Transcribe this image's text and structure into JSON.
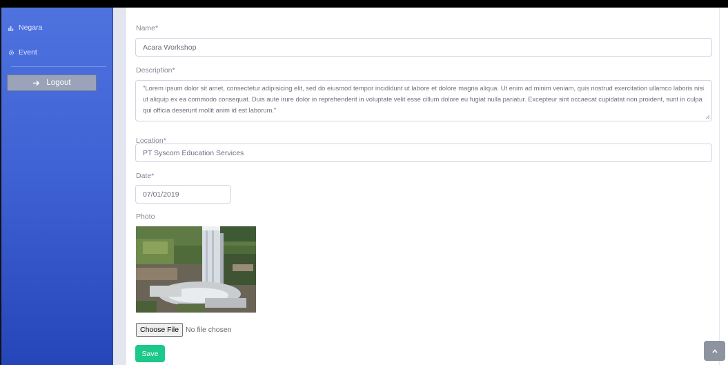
{
  "sidebar": {
    "items": [
      {
        "label": "Negara",
        "icon": "chart-icon"
      },
      {
        "label": "Event",
        "icon": "gear-icon"
      }
    ],
    "logout_label": "Logout"
  },
  "form": {
    "name_label": "Name*",
    "name_value": "Acara Workshop",
    "description_label": "Description*",
    "description_value": "\"Lorem ipsum dolor sit amet, consectetur adipisicing elit, sed do eiusmod tempor incididunt ut labore et dolore magna aliqua. Ut enim ad minim veniam, quis nostrud exercitation ullamco laboris nisi ut aliquip ex ea commodo consequat. Duis aute irure dolor in reprehenderit in voluptate velit esse cillum dolore eu fugiat nulla pariatur. Excepteur sint occaecat cupidatat non proident, sunt in culpa qui officia deserunt mollit anim id est laborum.\"",
    "location_label": "Location*",
    "location_value": "PT Syscom Education Services",
    "date_label": "Date*",
    "date_value": "07/01/2019",
    "photo_label": "Photo",
    "choose_file_label": "Choose File",
    "no_file_text": "No file chosen",
    "save_label": "Save"
  },
  "colors": {
    "sidebar_top": "#4e73df",
    "sidebar_bottom": "#2546b8",
    "save_button": "#1cc88a",
    "label_text": "#858796"
  }
}
